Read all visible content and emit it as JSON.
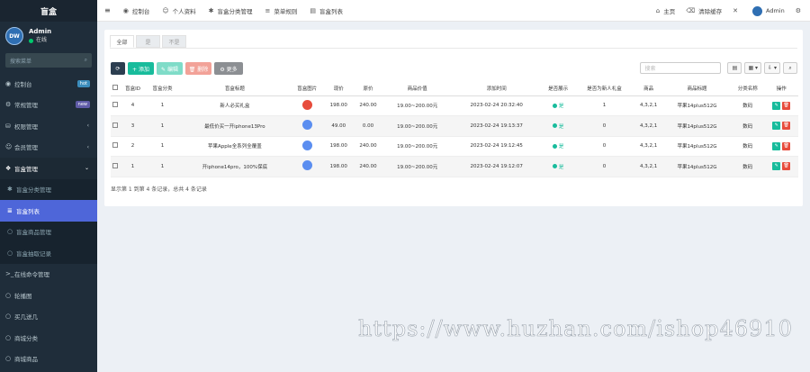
{
  "brand": "盲盒",
  "user": {
    "avatar_text": "DW",
    "name": "Admin",
    "status": "在线"
  },
  "search": {
    "placeholder": "搜索菜单"
  },
  "sidebar": {
    "items": [
      {
        "icon": "dashboard-icon",
        "glyph": "◉",
        "label": "控制台",
        "badge": "hot",
        "badge_color": "#3c8dbc"
      },
      {
        "icon": "gear-icon",
        "glyph": "⚙",
        "label": "常规管理",
        "badge": "new",
        "badge_color": "#605ca8"
      },
      {
        "icon": "database-icon",
        "glyph": "⛁",
        "label": "权限管理",
        "caret": "‹"
      },
      {
        "icon": "user-icon",
        "glyph": "☺",
        "label": "会员管理",
        "caret": "‹"
      },
      {
        "icon": "cubes-icon",
        "glyph": "❖",
        "label": "盲盒管理",
        "caret": "⌄"
      },
      {
        "icon": "gear-sub-icon",
        "glyph": "✱",
        "label": "盲盒分类管理"
      },
      {
        "icon": "list-icon",
        "glyph": "≣",
        "label": "盲盒列表"
      },
      {
        "icon": "circle-icon",
        "glyph": "○",
        "label": "盲盒商品管理"
      },
      {
        "icon": "circle-icon",
        "glyph": "○",
        "label": "盲盒抽取记录"
      },
      {
        "icon": "terminal-icon",
        "glyph": ">_",
        "label": "在线命令管理"
      },
      {
        "icon": "circle-icon",
        "glyph": "○",
        "label": "轮播图"
      },
      {
        "icon": "circle-icon",
        "glyph": "○",
        "label": "买几送几"
      },
      {
        "icon": "circle-icon",
        "glyph": "○",
        "label": "商城分类"
      },
      {
        "icon": "circle-icon",
        "glyph": "○",
        "label": "商城商品"
      }
    ]
  },
  "topbar": {
    "menu_icon": "≡",
    "items": [
      {
        "glyph": "◉",
        "label": "控制台"
      },
      {
        "glyph": "☺",
        "label": "个人资料"
      },
      {
        "glyph": "✱",
        "label": "盲盒分类管理"
      },
      {
        "glyph": "≡",
        "label": "菜单规则"
      },
      {
        "glyph": "▤",
        "label": "盲盒列表"
      }
    ],
    "right": [
      {
        "glyph": "⌂",
        "label": "主页"
      },
      {
        "glyph": "⌫",
        "label": "清除缓存"
      },
      {
        "glyph": "✕",
        "label": ""
      },
      {
        "glyph": "",
        "label": "Admin"
      },
      {
        "glyph": "⚙",
        "label": ""
      }
    ]
  },
  "tabs": [
    "全部",
    "是",
    "不是"
  ],
  "toolbar": {
    "refresh": "⟳",
    "add": "+ 添加",
    "edit": "✎ 编辑",
    "delete": "🗑 删除",
    "more": "⚙ 更多"
  },
  "table_search": {
    "placeholder": "搜索"
  },
  "table_tools": [
    "▤",
    "▦ ▾",
    "⇩ ▾",
    "⌕"
  ],
  "table": {
    "headers": [
      "盲盒ID",
      "盲盒分类",
      "盲盒标题",
      "盲盒图片",
      "现价",
      "原价",
      "商品价值",
      "添加时间",
      "是否展示",
      "是否为新人礼盒",
      "商品",
      "商品标题",
      "分类名称",
      "操作"
    ],
    "rows": [
      {
        "id": "4",
        "cat": "1",
        "title": "新人必买礼盒",
        "img": "red",
        "price": "198.00",
        "orig": "240.00",
        "value": "19.00~200.00元",
        "time": "2023-02-24 20:32:40",
        "show": "是",
        "newbie": "1",
        "goods": "4,3,2,1",
        "goods_title": "苹果14plus512G",
        "cat_name": "数码"
      },
      {
        "id": "3",
        "cat": "1",
        "title": "最低价买一开iphone13Pro",
        "img": "blue",
        "price": "49.00",
        "orig": "0.00",
        "value": "19.00~200.00元",
        "time": "2023-02-24 19:13:37",
        "show": "是",
        "newbie": "0",
        "goods": "4,3,2,1",
        "goods_title": "苹果14plus512G",
        "cat_name": "数码"
      },
      {
        "id": "2",
        "cat": "1",
        "title": "苹果Apple全系列全覆盖",
        "img": "blue",
        "price": "198.00",
        "orig": "240.00",
        "value": "19.00~200.00元",
        "time": "2023-02-24 19:12:45",
        "show": "是",
        "newbie": "0",
        "goods": "4,3,2,1",
        "goods_title": "苹果14plus512G",
        "cat_name": "数码"
      },
      {
        "id": "1",
        "cat": "1",
        "title": "开iphone14pro，100%保底",
        "img": "blue",
        "price": "198.00",
        "orig": "240.00",
        "value": "19.00~200.00元",
        "time": "2023-02-24 19:12:07",
        "show": "是",
        "newbie": "0",
        "goods": "4,3,2,1",
        "goods_title": "苹果14plus512G",
        "cat_name": "数码"
      }
    ]
  },
  "footer_info": "显示第 1 到第 4 条记录，总共 4 条记录",
  "watermark": "https://www.huzhan.com/ishop46910"
}
